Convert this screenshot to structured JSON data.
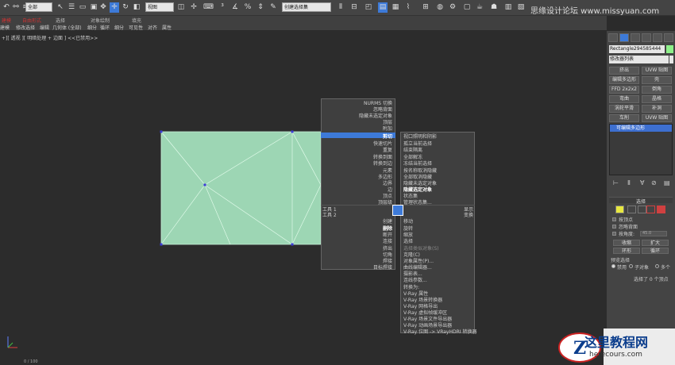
{
  "toolbar": {
    "select_all": "全部",
    "view_select": "视图",
    "named_sel": "创建选择集",
    "watermark": "思缘设计论坛  www.missyuan.com"
  },
  "ribbon": {
    "tabs": [
      "建模",
      "自由形式",
      "选择",
      "对象绘制",
      "填充"
    ]
  },
  "subribbon": {
    "items": [
      "建模",
      "修改选择",
      "编辑",
      "几何体 (全部)",
      "细分",
      "循环",
      "细分",
      "可见性",
      "对齐",
      "属性"
    ]
  },
  "viewport": {
    "label": "+][ 透视 ][ 明暗处理 + 边面 ] <<已禁用>>",
    "status": "0 / 100"
  },
  "right_panel": {
    "object_name": "Rectangle294585444",
    "modifier_list": "修改器列表",
    "buttons": [
      "挤出",
      "UVW 贴图",
      "编辑多边形",
      "壳",
      "FFD 2x2x2",
      "倒角",
      "弯曲",
      "晶格",
      "涡轮平滑",
      "补洞",
      "车削",
      "UVW 贴图"
    ],
    "stack_item": "可编辑多边形",
    "select_header": "选择",
    "by_vertex": "按顶点",
    "ignore_backface": "忽略背面",
    "by_angle": "按角度:",
    "angle_value": "45.0",
    "shrink": "收缩",
    "grow": "扩大",
    "ring": "环形",
    "loop": "循环",
    "preview_sel": "预览选择",
    "disable": "禁用",
    "subobject": "子对象",
    "multi": "多个",
    "selected_info": "选择了 0 个顶点"
  },
  "quad_left_top": {
    "items": [
      "NURMS 切换",
      "忽略背面",
      "隐藏未选定对象",
      "顶层",
      "附加"
    ]
  },
  "quad_left_highlight": "剪切",
  "quad_left_mid": {
    "items": [
      "快速切片",
      "重复",
      "转换到面",
      "转换到边",
      "元素",
      "多边形",
      "边界",
      "边",
      "顶点",
      "顶层级"
    ]
  },
  "quad_left_tools": [
    "工具 1",
    "工具 2"
  ],
  "quad_right_tools": [
    "显示",
    "变换"
  ],
  "quad_left_bottom": {
    "items": [
      "创建",
      "删除",
      "断开",
      "连接",
      "挤出",
      "切角",
      "焊接",
      "目标焊接"
    ]
  },
  "quad_right_top": {
    "items": [
      "视口照明和阴影",
      "孤立当前选择",
      "结束隔离",
      "全部解冻",
      "冻结当前选择",
      "按名称取消隐藏",
      "全部取消隐藏",
      "隐藏未选定对象",
      "隐藏选定对象",
      "状态集",
      "管理状态集..."
    ]
  },
  "quad_right_bottom": {
    "items": [
      "移动",
      "旋转",
      "缩放",
      "选择",
      "选择类似对象(S)",
      "克隆(C)",
      "对象属性(P)...",
      "曲线编辑器...",
      "摄影表...",
      "连线参数...",
      "转换为:",
      "V-Ray 属性",
      "V-Ray 场景转换器",
      "V-Ray 网格导出",
      "V-Ray 虚拟帧缓冲区",
      "V-Ray 场景文件导出器",
      "V-Ray 动画场景导出器",
      "V-Ray 位图 -> VRayHDRI 转换器"
    ]
  },
  "logo": {
    "title": "这里教程网",
    "sub": "herecours.com"
  },
  "colors": {
    "shape_fill": "#9dd6b4",
    "highlight": "#3d7ad8",
    "swatch": "#8ef08a"
  }
}
